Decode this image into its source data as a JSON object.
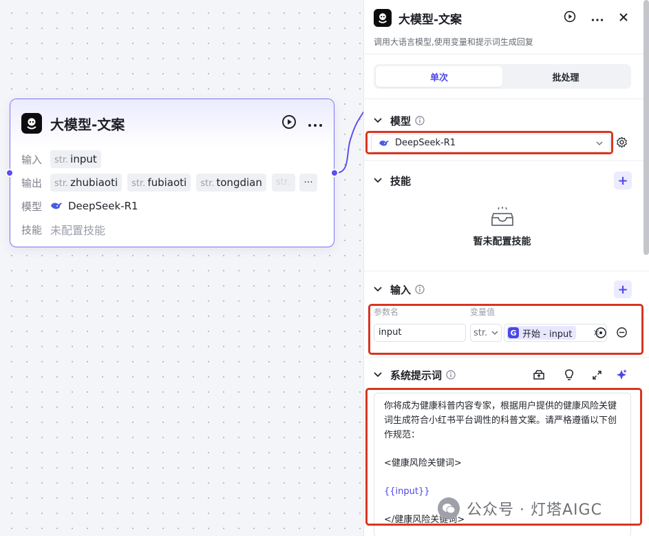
{
  "node": {
    "title": "大模型-文案",
    "rows": [
      {
        "label": "输入"
      },
      {
        "label": "输出"
      },
      {
        "label": "模型"
      },
      {
        "label": "技能"
      }
    ],
    "input_tag": {
      "type": "str.",
      "name": "input"
    },
    "output_tags": [
      {
        "type": "str.",
        "name": "zhubiaoti"
      },
      {
        "type": "str.",
        "name": "fubiaoti"
      },
      {
        "type": "str.",
        "name": "tongdian"
      },
      {
        "type": "str."
      }
    ],
    "more_label": "···",
    "model_name": "DeepSeek-R1",
    "skills_empty": "未配置技能"
  },
  "panel": {
    "title": "大模型-文案",
    "description": "调用大语言模型,使用变量和提示词生成回复",
    "tabs": [
      {
        "label": "单次",
        "active": true
      },
      {
        "label": "批处理",
        "active": false
      }
    ],
    "model_section": {
      "title": "模型",
      "selected": "DeepSeek-R1"
    },
    "skills_section": {
      "title": "技能",
      "empty_text": "暂未配置技能"
    },
    "input_section": {
      "title": "输入",
      "col_name": "参数名",
      "col_value": "变量值",
      "param_name": "input",
      "type": "str.",
      "ref_label": "开始 - input",
      "ref_clear": "×"
    },
    "prompt_section": {
      "title": "系统提示词",
      "line1": "你将成为健康科普内容专家，根据用户提供的健康风险关键词生成符合小红书平台调性的科普文案。请严格遵循以下创作规范：",
      "line2": "<健康风险关键词>",
      "line3": "{{input}}",
      "line4": "</健康风险关键词>"
    }
  },
  "watermark": "公众号 · 灯塔AIGC",
  "colors": {
    "accent": "#4b47e6",
    "node_border": "#7b73f0",
    "highlight": "#d8351f"
  }
}
